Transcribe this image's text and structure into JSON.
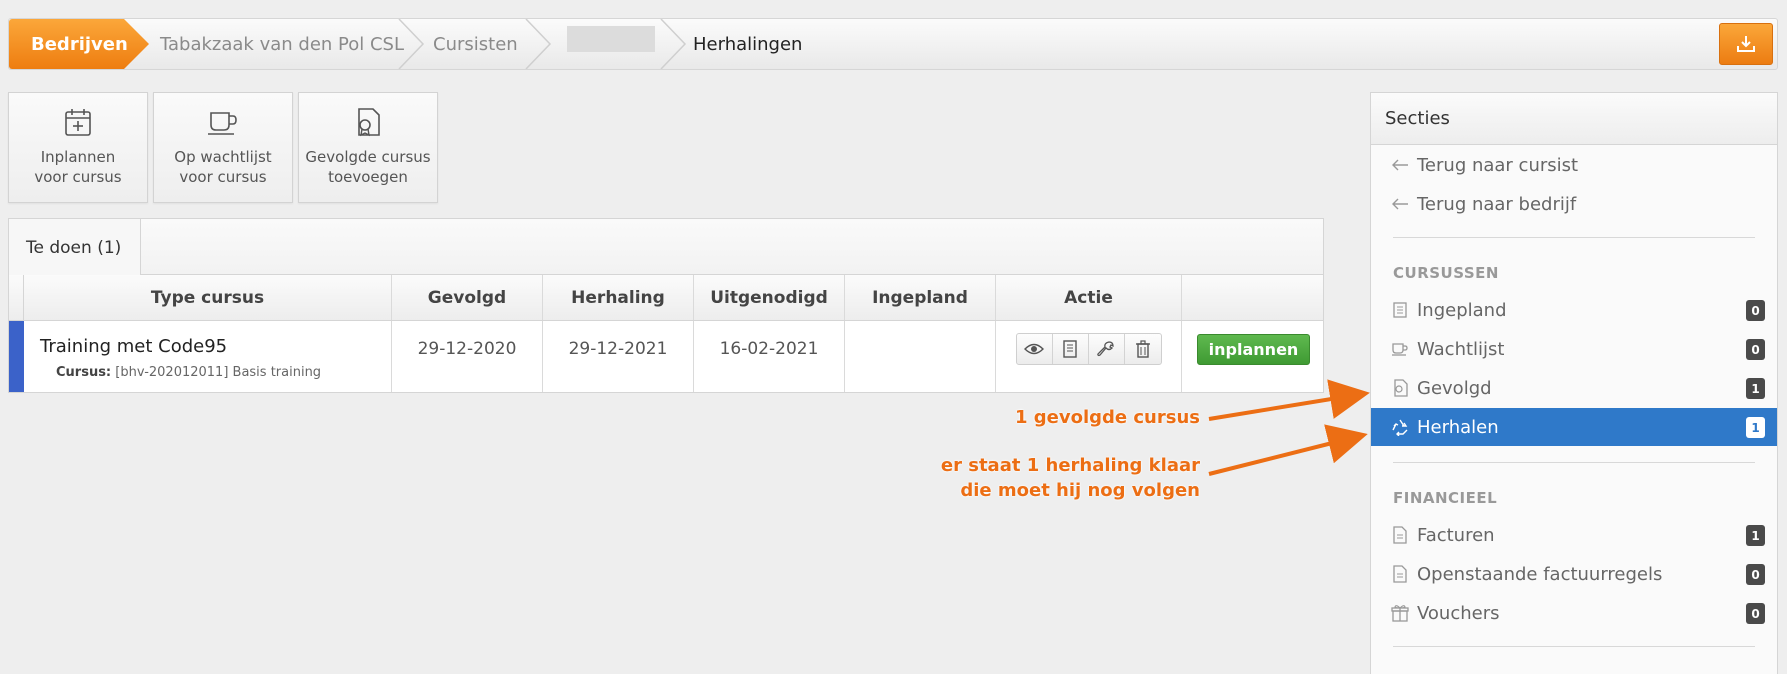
{
  "breadcrumb": {
    "items": [
      "Bedrijven",
      "Tabakzaak van den Pol CSL",
      "Cursisten",
      "",
      "Herhalingen"
    ]
  },
  "actions": [
    {
      "line1": "Inplannen",
      "line2": "voor cursus",
      "icon": "calendar-plus-icon"
    },
    {
      "line1": "Op wachtlijst",
      "line2": "voor cursus",
      "icon": "coffee-cup-icon"
    },
    {
      "line1": "Gevolgde cursus",
      "line2": "toevoegen",
      "icon": "certificate-icon"
    }
  ],
  "tabs": [
    {
      "label": "Te doen (1)"
    }
  ],
  "table": {
    "columns": [
      "Type cursus",
      "Gevolgd",
      "Herhaling",
      "Uitgenodigd",
      "Ingepland",
      "Actie",
      ""
    ],
    "rows": [
      {
        "title": "Training met Code95",
        "sub_label": "Cursus:",
        "sub_value": "[bhv-202012011] Basis training",
        "gevolgd": "29-12-2020",
        "herhaling": "29-12-2021",
        "uitgenodigd": "16-02-2021",
        "ingepland": "",
        "button": "inplannen"
      }
    ]
  },
  "annotations": {
    "a1": "1 gevolgde cursus",
    "a2_line1": "er staat 1 herhaling klaar",
    "a2_line2": "die moet hij nog volgen",
    "color": "#ec6e14"
  },
  "sidebar": {
    "title": "Secties",
    "back_links": [
      "Terug naar cursist",
      "Terug naar bedrijf"
    ],
    "section1": "CURSUSSEN",
    "cursus_items": [
      {
        "label": "Ingepland",
        "count": "0"
      },
      {
        "label": "Wachtlijst",
        "count": "0"
      },
      {
        "label": "Gevolgd",
        "count": "1"
      },
      {
        "label": "Herhalen",
        "count": "1"
      }
    ],
    "section2": "FINANCIEEL",
    "fin_items": [
      {
        "label": "Facturen",
        "count": "1"
      },
      {
        "label": "Openstaande factuurregels",
        "count": "0"
      },
      {
        "label": "Vouchers",
        "count": "0"
      }
    ]
  },
  "colors": {
    "accent": "#ee7d10",
    "active": "#2f79c9",
    "row_marker": "#3b62c9",
    "button_green": "#4aa53c"
  }
}
